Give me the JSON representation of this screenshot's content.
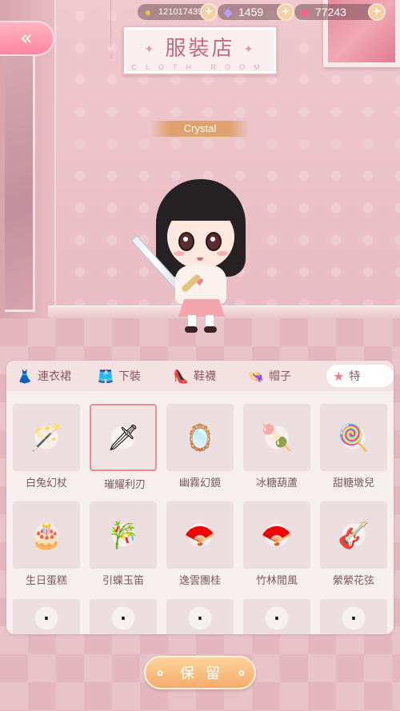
{
  "topbar": {
    "coins": {
      "icon": "coin-cat-icon",
      "value": "121017439"
    },
    "diamonds": {
      "icon": "purple-gem-icon",
      "value": "1459"
    },
    "rubies": {
      "icon": "pink-gem-icon",
      "value": "77243"
    }
  },
  "back_button": {
    "icon": "double-chevron-left-icon",
    "glyph": "«"
  },
  "shop_sign": {
    "title": "服裝店",
    "subtitle": "CLOTH ROOM"
  },
  "character": {
    "name": "Crystal"
  },
  "tabs": [
    {
      "icon": "dress-icon",
      "glyph": "👗",
      "label": "連衣裙"
    },
    {
      "icon": "pants-icon",
      "glyph": "🩳",
      "label": "下裝"
    },
    {
      "icon": "high-heel-icon",
      "glyph": "👠",
      "label": "鞋襪"
    },
    {
      "icon": "hat-icon",
      "glyph": "👒",
      "label": "帽子"
    },
    {
      "icon": "star-icon",
      "glyph": "★",
      "label": "特"
    }
  ],
  "items": [
    {
      "label": "白兔幻杖",
      "icon": "wand-icon",
      "glyph": "🪄"
    },
    {
      "label": "璀耀利刃",
      "icon": "sword-icon",
      "glyph": "🗡"
    },
    {
      "label": "幽霧幻鏡",
      "icon": "mirror-icon",
      "glyph": "🪞"
    },
    {
      "label": "冰糖葫蘆",
      "icon": "candied-haws-icon",
      "glyph": "🍡"
    },
    {
      "label": "甜糖墩兒",
      "icon": "candy-stick-icon",
      "glyph": "🍭"
    },
    {
      "label": "生日蛋糕",
      "icon": "cake-icon",
      "glyph": "🎂"
    },
    {
      "label": "引蝶玉笛",
      "icon": "flute-icon",
      "glyph": "🎋"
    },
    {
      "label": "逸雲團桂",
      "icon": "round-fan-icon",
      "glyph": "🪭"
    },
    {
      "label": "竹林閒風",
      "icon": "folding-fan-icon",
      "glyph": "🪭"
    },
    {
      "label": "縈縈花弦",
      "icon": "guitar-icon",
      "glyph": "🎸"
    }
  ],
  "partial_row": [
    {
      "icon": "partial-item-icon",
      "glyph": "·"
    },
    {
      "icon": "partial-item-icon",
      "glyph": "·"
    },
    {
      "icon": "partial-item-icon",
      "glyph": "·"
    },
    {
      "icon": "partial-item-icon",
      "glyph": "·"
    },
    {
      "icon": "partial-item-icon",
      "glyph": "·"
    }
  ],
  "selected_item": "璀耀利刃",
  "keep_button": {
    "label": "保留"
  },
  "colors": {
    "accent_pink": "#ff86a2",
    "selection_border": "#ef8a90",
    "button_orange": "#f3ad6a",
    "tab_text": "#8a5860"
  }
}
